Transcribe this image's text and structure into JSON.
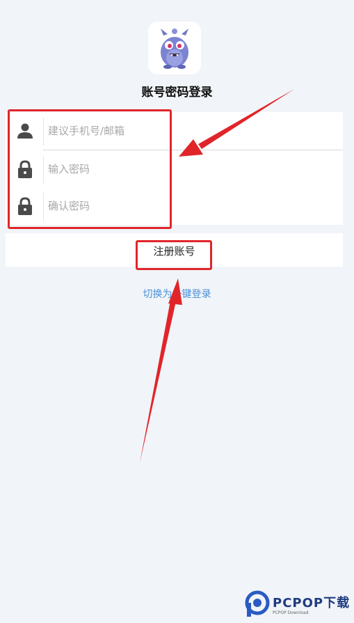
{
  "header": {
    "title": "账号密码登录",
    "logo_icon": "monster-mascot-icon"
  },
  "form": {
    "account": {
      "placeholder": "建议手机号/邮箱",
      "icon": "user-icon"
    },
    "password": {
      "placeholder": "输入密码",
      "icon": "lock-icon"
    },
    "confirm_password": {
      "placeholder": "确认密码",
      "icon": "lock-icon"
    }
  },
  "actions": {
    "register_label": "注册账号",
    "switch_label": "切换为一键登录"
  },
  "annotations": {
    "color": "#e0252a"
  },
  "watermark": {
    "text": "PCPOP下载",
    "subtext": "PCPOP Download"
  },
  "colors": {
    "background": "#f1f4f8",
    "link": "#4a90d9",
    "icon": "#4a4a4a"
  }
}
